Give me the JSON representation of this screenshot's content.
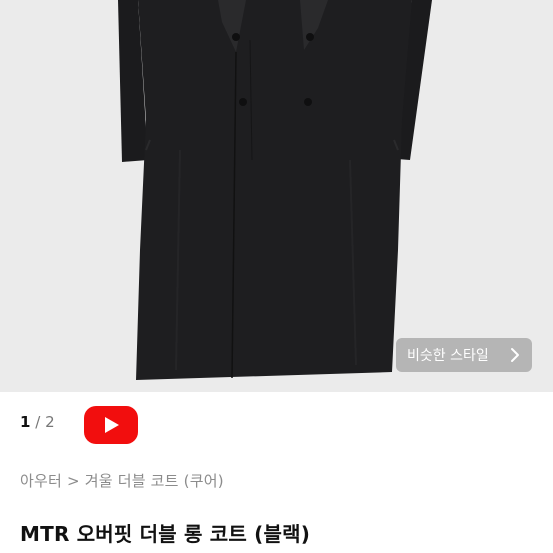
{
  "product_image": {
    "similar_style_label": "비슷한 스타일",
    "icon": "chevron-right-icon",
    "background_color": "#ebebeb",
    "coat_color": "#1d1d1f"
  },
  "pager": {
    "current": "1",
    "separator": "/",
    "total": "2"
  },
  "video_button": {
    "icon": "youtube-play-icon",
    "color": "#f20e0e"
  },
  "breadcrumb": {
    "category": "아우터",
    "separator": ">",
    "subcategory": "겨울 더블 코트 (쿠어)"
  },
  "product": {
    "title": "MTR 오버핏 더블 롱 코트 (블랙)"
  }
}
